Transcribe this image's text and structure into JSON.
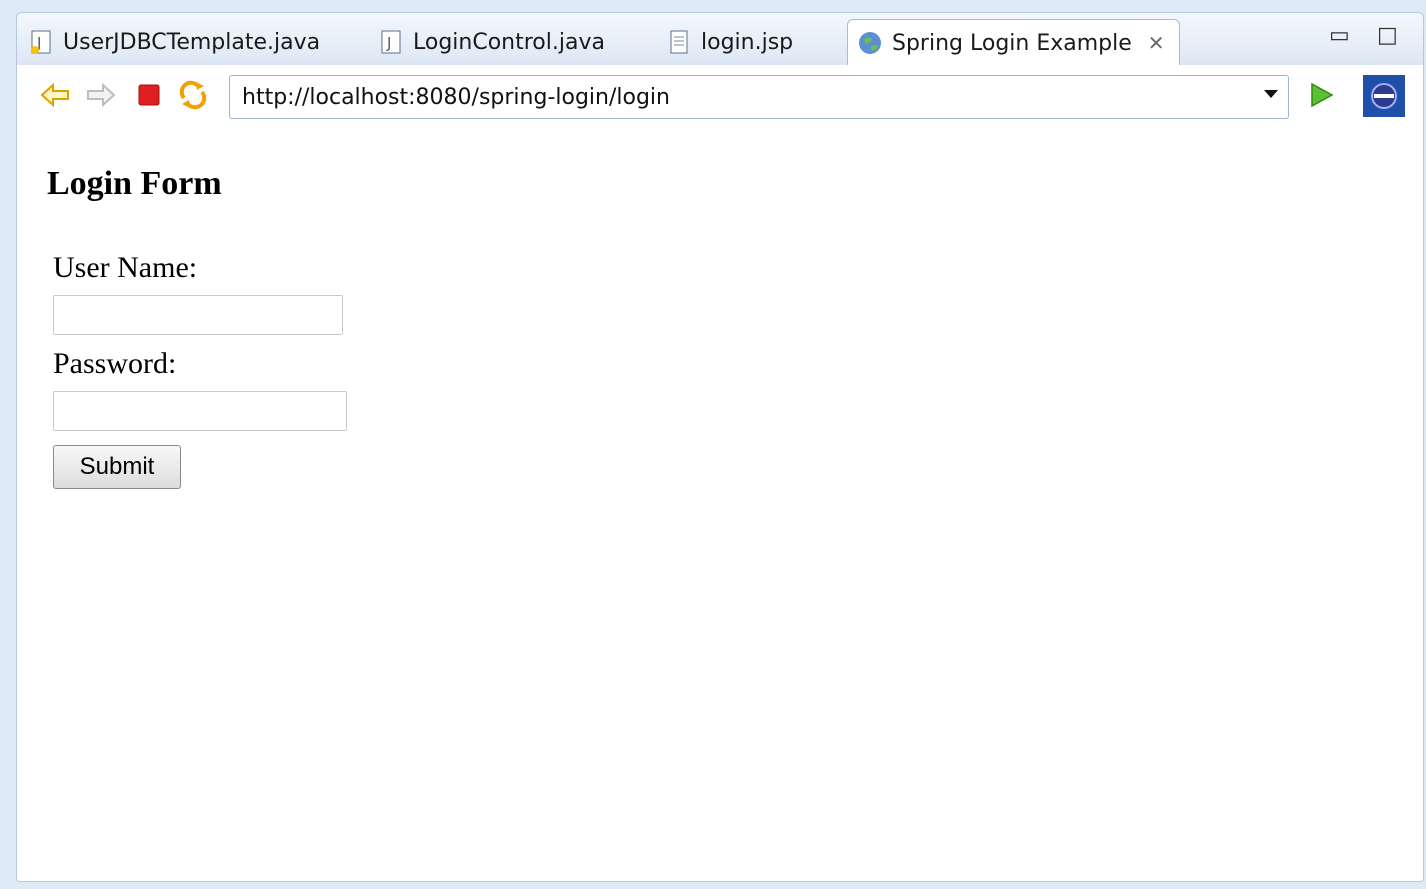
{
  "tabs": [
    {
      "label": "UserJDBCTemplate.java",
      "icon": "java-file-warning-icon",
      "active": false
    },
    {
      "label": "LoginControl.java",
      "icon": "java-file-icon",
      "active": false
    },
    {
      "label": "login.jsp",
      "icon": "jsp-file-icon",
      "active": false
    },
    {
      "label": "Spring Login Example",
      "icon": "globe-icon",
      "active": true
    }
  ],
  "window_controls": {
    "minimize": "minimize-icon",
    "maximize": "maximize-icon"
  },
  "toolbar": {
    "url": "http://localhost:8080/spring-login/login",
    "icons": [
      "back-arrow-icon",
      "forward-arrow-icon",
      "stop-icon",
      "refresh-icon",
      "go-icon",
      "eclipse-icon"
    ]
  },
  "page": {
    "title": "Login Form",
    "username_label": "User Name:",
    "password_label": "Password:",
    "username_value": "",
    "password_value": "",
    "submit_label": "Submit"
  },
  "colors": {
    "accent": "#2f6db5",
    "stop": "#e02020",
    "arrow": "#f0a000",
    "go": "#3aa020"
  }
}
